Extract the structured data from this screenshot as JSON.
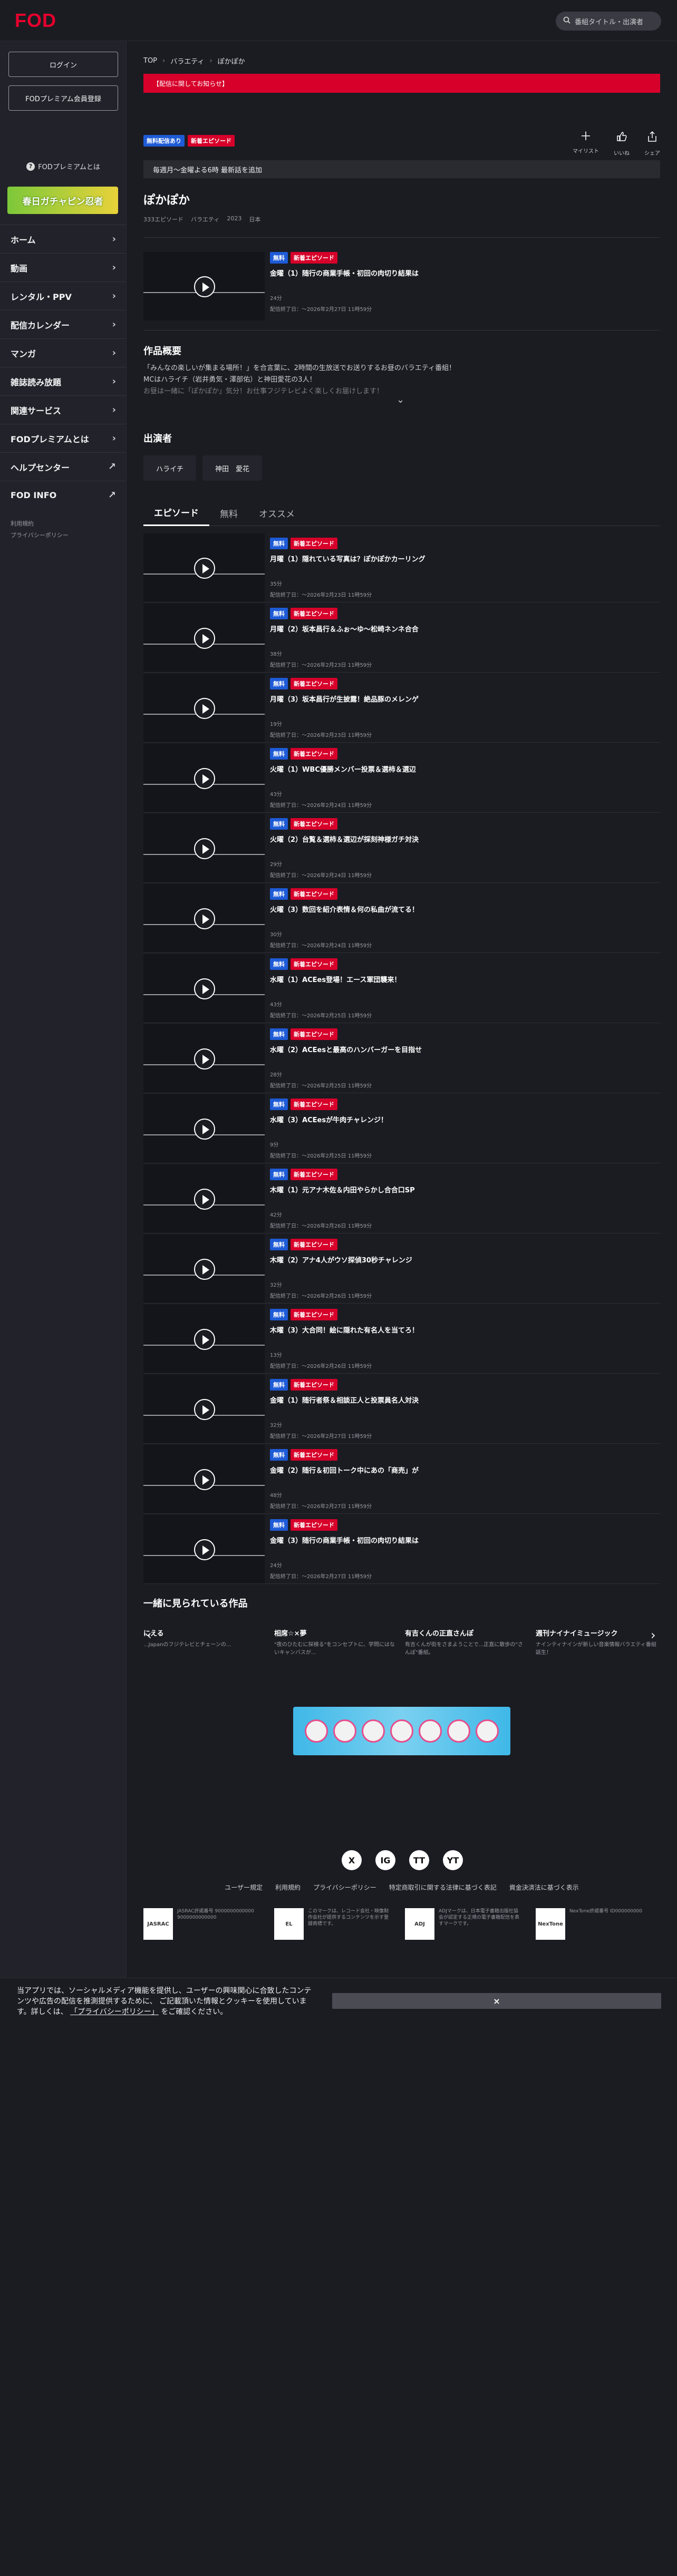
{
  "header": {
    "logo": "FOD",
    "search_placeholder": "番組タイトル・出演者"
  },
  "sidebar": {
    "login": "ログイン",
    "register": "FODプレミアム会員登録",
    "about": "FODプレミアムとは",
    "banner_text": "春日ガチャピン忍者",
    "items": [
      {
        "label": "ホーム"
      },
      {
        "label": "動画"
      },
      {
        "label": "レンタル・PPV"
      },
      {
        "label": "配信カレンダー"
      },
      {
        "label": "マンガ"
      },
      {
        "label": "雑誌読み放題"
      },
      {
        "label": "関連サービス"
      },
      {
        "label": "FODプレミアムとは"
      },
      {
        "label": "ヘルプセンター"
      },
      {
        "label": "FOD INFO"
      }
    ],
    "footer_links": [
      "利用規約",
      "プライバシーポリシー"
    ]
  },
  "breadcrumb": [
    "TOP",
    "バラエティ",
    "ぽかぽか"
  ],
  "alert": "【配信に関してお知らせ】",
  "actions": [
    {
      "icon": "plus-icon",
      "label": "マイリスト"
    },
    {
      "icon": "thumbs-up-icon",
      "label": "いいね"
    },
    {
      "icon": "share-icon",
      "label": "シェア"
    }
  ],
  "badges": {
    "free_now": "無料配信あり",
    "new_episode": "新着エピソード",
    "free": "無料"
  },
  "schedule": "毎週月～金曜よる6時 最新話を追加",
  "program": {
    "title": "ぽかぽか",
    "meta": [
      "333エピソード",
      "バラエティ",
      "2023",
      "日本"
    ]
  },
  "featured_episode": {
    "title": "金曜（1）随行の商業手帳・初回の肉切り結果は",
    "duration": "24分",
    "until": "配信終了日：～2026年2月27日 11時59分"
  },
  "overview": {
    "heading": "作品概要",
    "lines": [
      "「みんなの楽しいが集まる場所！」を合言葉に、2時間の生放送でお送りするお昼のバラエティ番組！",
      "MCはハライチ（岩井勇気・澤部佑）と神田愛花の3人！",
      "お昼は一緒に「ぽかぽか」気分！お仕事フジテレビよく楽しくお届けします！"
    ]
  },
  "cast": {
    "heading": "出演者",
    "members": [
      "ハライチ",
      "神田　愛花"
    ]
  },
  "tabs": [
    "エピソード",
    "無料",
    "オススメ"
  ],
  "episodes": [
    {
      "title": "月曜（1）隠れている写真は？ぽかぽかカーリング",
      "duration": "35分",
      "until": "配信終了日：～2026年2月23日 11時59分"
    },
    {
      "title": "月曜（2）坂本昌行＆ふぉ～ゆ～松崎ネンネ合合",
      "duration": "38分",
      "until": "配信終了日：～2026年2月23日 11時59分"
    },
    {
      "title": "月曜（3）坂本昌行が生披露！絶品豚のメレンゲ",
      "duration": "19分",
      "until": "配信終了日：～2026年2月23日 11時59分"
    },
    {
      "title": "火曜（1）WBC優勝メンバー投票＆選柿＆選辺",
      "duration": "43分",
      "until": "配信終了日：～2026年2月24日 11時59分"
    },
    {
      "title": "火曜（2）台覧＆選柿＆選辺が採刻神様ガチ対決",
      "duration": "29分",
      "until": "配信終了日：～2026年2月24日 11時59分"
    },
    {
      "title": "火曜（3）数回を紹介表情＆何の私曲が流てる！",
      "duration": "30分",
      "until": "配信終了日：～2026年2月24日 11時59分"
    },
    {
      "title": "水曜（1）ACEes登場！エース軍団襲来！",
      "duration": "43分",
      "until": "配信終了日：～2026年2月25日 11時59分"
    },
    {
      "title": "水曜（2）ACEesと最高のハンバーガーを目指せ",
      "duration": "28分",
      "until": "配信終了日：～2026年2月25日 11時59分"
    },
    {
      "title": "水曜（3）ACEesが牛肉チャレンジ！",
      "duration": "9分",
      "until": "配信終了日：～2026年2月25日 11時59分"
    },
    {
      "title": "木曜（1）元アナ木佐＆内田やらかし合合口SP",
      "duration": "42分",
      "until": "配信終了日：～2026年2月26日 11時59分"
    },
    {
      "title": "木曜（2）アナ4人がウソ探偵30秒チャレンジ",
      "duration": "32分",
      "until": "配信終了日：～2026年2月26日 11時59分"
    },
    {
      "title": "木曜（3）大合同！絵に隠れた有名人を当てろ！",
      "duration": "13分",
      "until": "配信終了日：～2026年2月26日 11時59分"
    },
    {
      "title": "金曜（1）随行者祭＆相談正人と投票員名人対決",
      "duration": "32分",
      "until": "配信終了日：～2026年2月27日 11時59分"
    },
    {
      "title": "金曜（2）随行＆初回トーク中にあの「商売」が",
      "duration": "48分",
      "until": "配信終了日：～2026年2月27日 11時59分"
    },
    {
      "title": "金曜（3）随行の商業手帳・初回の肉切り結果は",
      "duration": "24分",
      "until": "配信終了日：～2026年2月27日 11時59分"
    }
  ],
  "related": {
    "heading": "一緒に見られている作品",
    "items": [
      {
        "title": "にえる",
        "desc": "...Japanのフジテレビとチェーンの..."
      },
      {
        "title": "相席☆×夢",
        "desc": "\"夜のひたむに探検る\"をコンセプトに、学問にはないキャンバスが..."
      },
      {
        "title": "有吉くんの正直さんぽ",
        "desc": "有吉くんが街をさまようことで...正直に散歩の\"さんぽ\"番組。"
      },
      {
        "title": "週刊ナイナイミュージック",
        "desc": "ナインティナインが新しい音楽情報バラエティ番組誕生！"
      }
    ]
  },
  "ad": {
    "label": "ad-banner"
  },
  "footer": {
    "social": [
      "X",
      "IG",
      "TT",
      "YT"
    ],
    "links": [
      "ユーザー規定",
      "利用規約",
      "プライバシーポリシー",
      "特定商取引に関する法律に基づく表記",
      "資金決済法に基づく表示"
    ],
    "badges": [
      {
        "logo": "JASRAC",
        "text": "JASRAC許諾番号 9000000000000 9000000000000"
      },
      {
        "logo": "EL",
        "text": "このマークは、レコード会社・映像制作会社が提供するコンテンツを示す登録商標です。"
      },
      {
        "logo": "ADJ",
        "text": "ADJマークは、日本電子書籍出版社協会が認定する正規の電子書籍配信を表すマークです。"
      },
      {
        "logo": "NexTone",
        "text": "NexTone許諾番号 ID000000000"
      }
    ]
  },
  "cookie": {
    "text1": "当アプリでは、ソーシャルメディア機能を提供し、ユーザーの興味関心に合致したコンテンツや広告の配信を推測提供するために、",
    "text2": "ご記載頂いた情報とクッキーを使用しています。詳しくは、",
    "link": "「プライバシーポリシー」",
    "text3": "をご確認ください。",
    "close": "×"
  }
}
